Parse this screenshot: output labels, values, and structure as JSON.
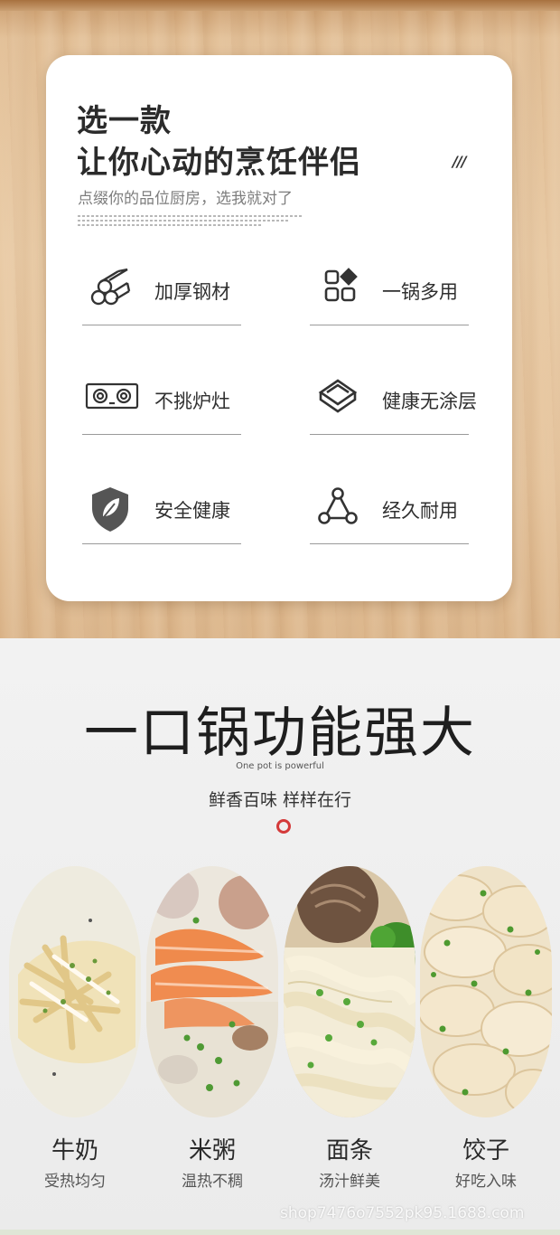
{
  "top": {
    "title_line1": "选一款",
    "title_line2": "让你心动的烹饪伴侣",
    "slashes": "///",
    "subtitle": "点缀你的品位厨房，选我就对了",
    "features": [
      {
        "label": "加厚钢材",
        "icon": "steel-rods-icon"
      },
      {
        "label": "一锅多用",
        "icon": "grid-shapes-icon"
      },
      {
        "label": "不挑炉灶",
        "icon": "stove-icon"
      },
      {
        "label": "健康无涂层",
        "icon": "layers-icon"
      },
      {
        "label": "安全健康",
        "icon": "shield-leaf-icon"
      },
      {
        "label": "经久耐用",
        "icon": "nodes-icon"
      }
    ]
  },
  "bottom": {
    "title": "一口锅功能强大",
    "subtitle_en": "One pot is powerful",
    "subtitle_cn": "鲜香百味 样样在行",
    "accent_color": "#d43a3a",
    "foods": [
      {
        "name": "牛奶",
        "desc": "受热均匀"
      },
      {
        "name": "米粥",
        "desc": "温热不稠"
      },
      {
        "name": "面条",
        "desc": "汤汁鲜美"
      },
      {
        "name": "饺子",
        "desc": "好吃入味"
      }
    ],
    "watermark": "shop7476o7552pk95.1688.com"
  }
}
